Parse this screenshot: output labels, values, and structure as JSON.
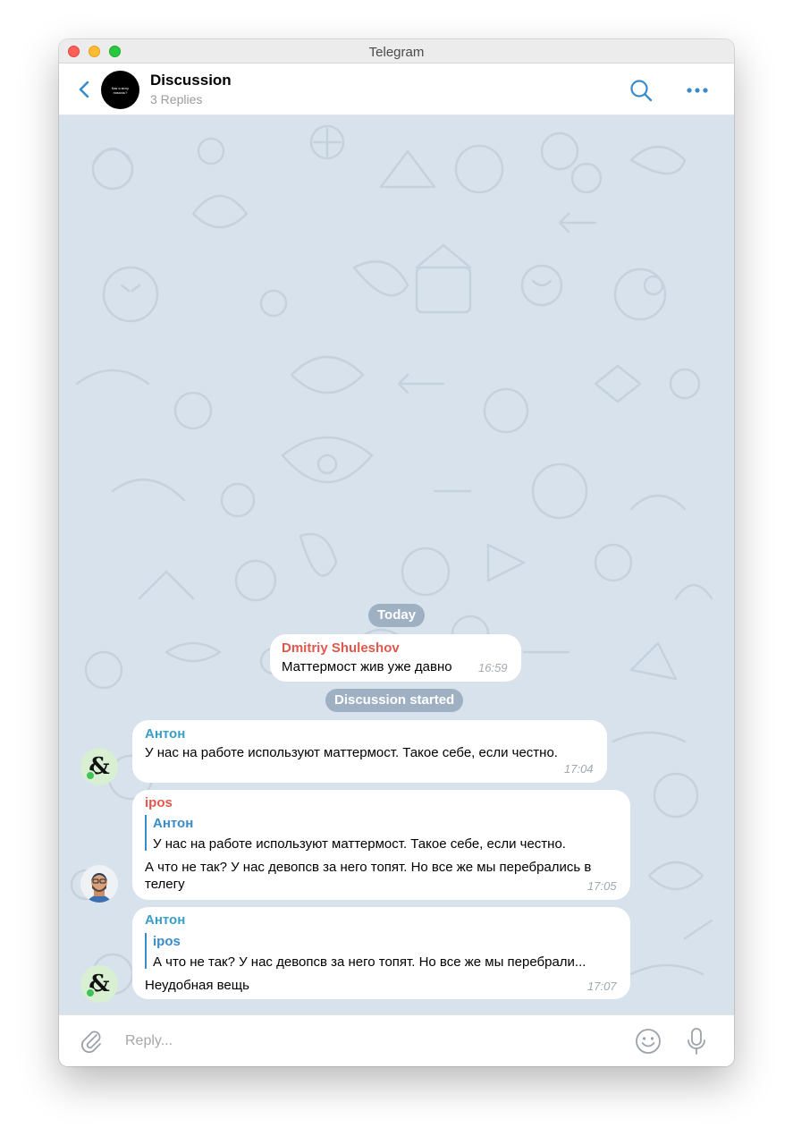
{
  "window": {
    "title": "Telegram"
  },
  "header": {
    "title": "Discussion",
    "subtitle": "3 Replies",
    "avatar_text": "Как я могу помочь?"
  },
  "icons": {
    "back": "chevron-left-icon",
    "search": "search-icon",
    "more": "more-horizontal-icon",
    "attach": "paperclip-icon",
    "emoji": "emoji-icon",
    "mic": "microphone-icon"
  },
  "colors": {
    "accent": "#3a8bc9",
    "sender_red": "#e0584c",
    "sender_blue": "#3a9ec9",
    "chat_bg": "#d7e2ec"
  },
  "separators": {
    "today": "Today",
    "discussion_started": "Discussion started"
  },
  "messages": [
    {
      "sender": "Dmitriy Shuleshov",
      "text": "Маттермост жив уже давно",
      "time": "16:59"
    },
    {
      "sender": "Антон",
      "text": "У нас на работе используют маттермост. Такое себе, если честно.",
      "time": "17:04"
    },
    {
      "sender": "ipos",
      "reply_to": {
        "sender": "Антон",
        "text": "У нас на работе используют маттермост. Такое себе, если честно."
      },
      "text": "А что не так? У нас девопсв за него топят. Но все же мы перебрались в телегу",
      "time": "17:05"
    },
    {
      "sender": "Антон",
      "reply_to": {
        "sender": "ipos",
        "text": "А что не так? У нас девопсв за него топят. Но все же мы перебрали..."
      },
      "text": "Неудобная вещь",
      "time": "17:07"
    }
  ],
  "composer": {
    "placeholder": "Reply..."
  }
}
